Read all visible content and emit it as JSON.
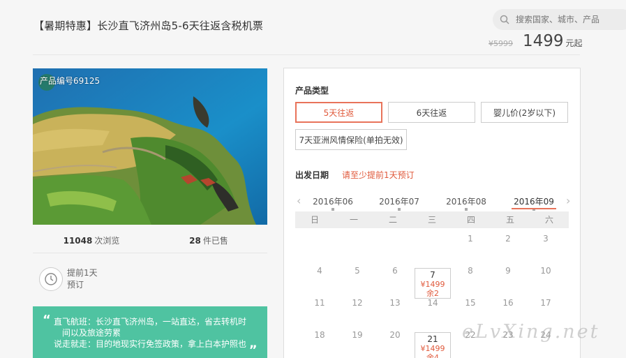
{
  "header": {
    "title": "【暑期特惠】长沙直飞济州岛5-6天往返含税机票",
    "search_placeholder": "搜索国家、城市、产品",
    "old_price": "¥5999",
    "price": "1499",
    "price_unit": "元起"
  },
  "product": {
    "code_label": "产品编号69125",
    "views_count": "11048",
    "views_label": "次浏览",
    "sold_count": "28",
    "sold_label": "件已售",
    "advance_line1": "提前1天",
    "advance_line2": "预订",
    "highlight_line1": "直飞航班：长沙直飞济州岛，一站直达，省去转机时",
    "highlight_line2": "间以及旅途劳累",
    "highlight_line3": "说走就走：目的地现实行免签政策，拿上白本护照也",
    "quote_open": "“",
    "quote_close": "„"
  },
  "booking": {
    "type_label": "产品类型",
    "options": [
      "5天往返",
      "6天往返",
      "婴儿价(2岁以下)",
      "7天亚洲风情保险(单拍无效)"
    ],
    "selected_option": 0,
    "date_label": "出发日期",
    "date_notice": "请至少提前1天预订",
    "prev_icon": "‹",
    "next_icon": "›",
    "months": [
      "2016年06",
      "2016年07",
      "2016年08",
      "2016年09"
    ],
    "active_month": 3,
    "weekdays": [
      "日",
      "一",
      "二",
      "三",
      "四",
      "五",
      "六"
    ],
    "weeks": [
      [
        "",
        "",
        "",
        "",
        "1",
        "2",
        "3"
      ],
      [
        "4",
        "5",
        "6",
        "7",
        "8",
        "9",
        "10"
      ],
      [
        "11",
        "12",
        "13",
        "14",
        "15",
        "16",
        "17"
      ],
      [
        "18",
        "19",
        "20",
        "21",
        "22",
        "23",
        "24"
      ]
    ],
    "available": {
      "7": {
        "price": "¥1499",
        "remain": "余2"
      },
      "21": {
        "price": "¥1499",
        "remain": "余4"
      }
    }
  },
  "watermark": "eLvXing.net",
  "colors": {
    "accent": "#e8735a",
    "green_box": "#4fc3a1"
  }
}
